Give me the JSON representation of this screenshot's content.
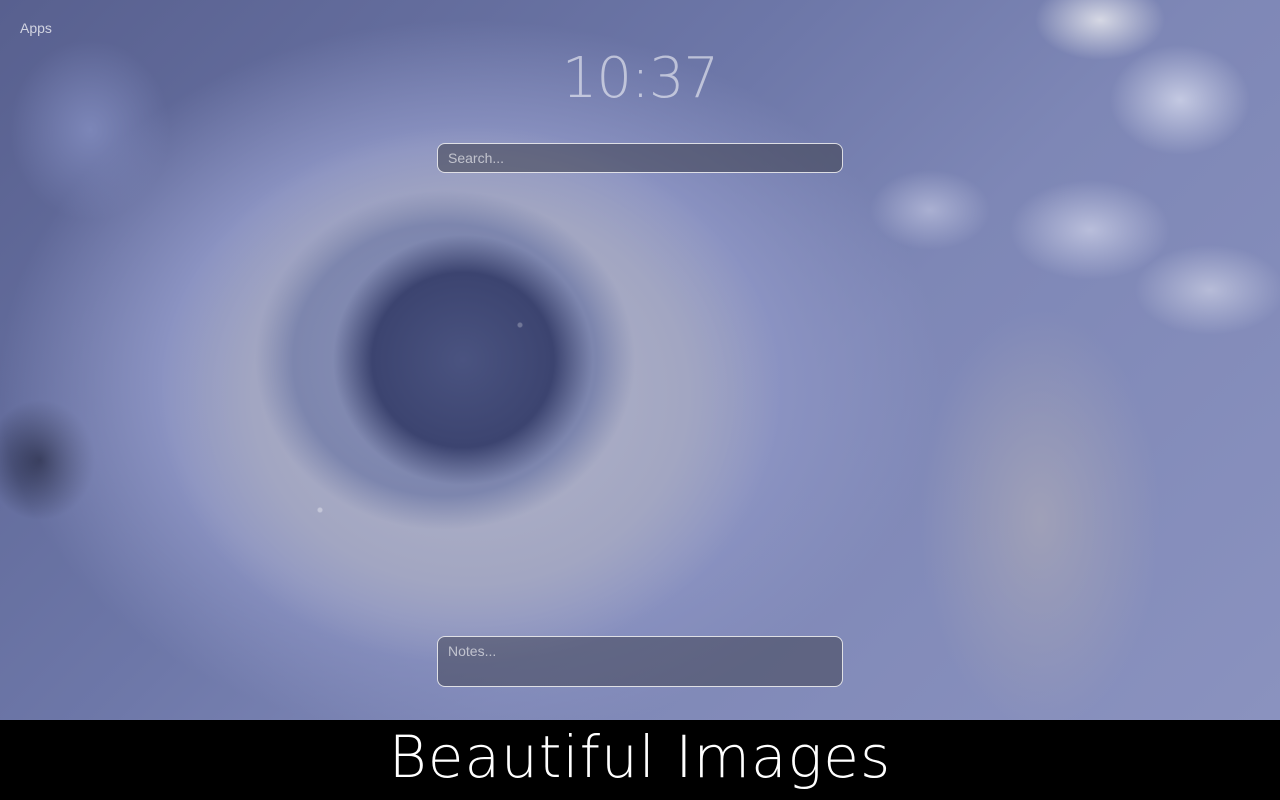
{
  "header": {
    "apps_label": "Apps",
    "clock": "10:37"
  },
  "search": {
    "placeholder": "Search..."
  },
  "notes": {
    "placeholder": "Notes..."
  },
  "footer": {
    "title": "Beautiful Images"
  },
  "background": {
    "icon": "stacked-stones-photo",
    "colors": {
      "stone_dark": "#4a5380",
      "stone_mid": "#8c93b8",
      "stone_light": "#b3b5c8",
      "footer_bg": "#000000"
    }
  }
}
